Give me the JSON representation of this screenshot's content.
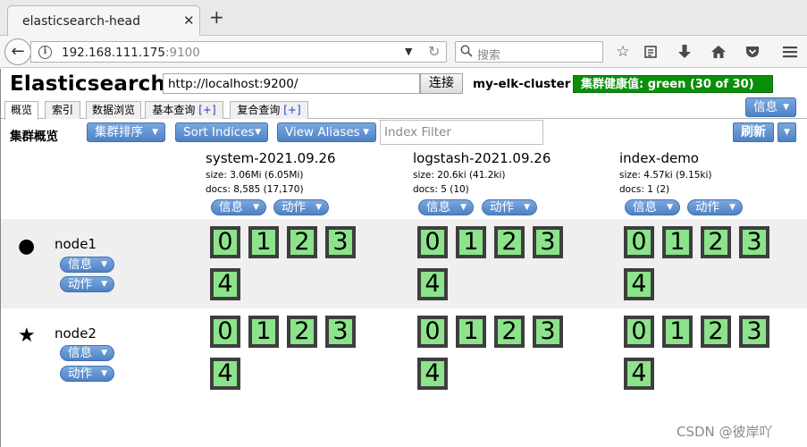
{
  "browser": {
    "tab_title": "elasticsearch-head",
    "tab_close": "✕",
    "new_tab": "+",
    "url_host": "192.168.111.175",
    "url_port": ":9100",
    "search_placeholder": "搜索"
  },
  "app": {
    "title": "Elasticsearch",
    "connection_url": "http://localhost:9200/",
    "connect_label": "连接",
    "cluster_name": "my-elk-cluster",
    "health_label": "集群健康值: ",
    "health_value": "green (30 of 30)",
    "health_color": "#0b8f0b",
    "tabs": [
      {
        "label": "概览",
        "plus": ""
      },
      {
        "label": "索引",
        "plus": ""
      },
      {
        "label": "数据浏览",
        "plus": ""
      },
      {
        "label": "基本查询",
        "plus": "[+]"
      },
      {
        "label": "复合查询",
        "plus": "[+]"
      }
    ],
    "info_label": "信息",
    "toolbar": {
      "overview_label": "集群概览",
      "sort_cluster_label": "集群排序",
      "sort_indices_label": "Sort Indices",
      "view_aliases_label": "View Aliases",
      "index_filter_placeholder": "Index Filter",
      "refresh_label": "刷新"
    }
  },
  "indices": [
    {
      "name": "system-2021.09.26",
      "size": "size: 3.06Mi (6.05Mi)",
      "docs": "docs: 8,585 (17,170)",
      "info_label": "信息",
      "action_label": "动作"
    },
    {
      "name": "logstash-2021.09.26",
      "size": "size: 20.6ki (41.2ki)",
      "docs": "docs: 5 (10)",
      "info_label": "信息",
      "action_label": "动作"
    },
    {
      "name": "index-demo",
      "size": "size: 4.57ki (9.15ki)",
      "docs": "docs: 1 (2)",
      "info_label": "信息",
      "action_label": "动作"
    }
  ],
  "nodes": [
    {
      "name": "node1",
      "icon": "●",
      "icon_name": "master-node-dot-icon",
      "info_label": "信息",
      "action_label": "动作",
      "shards": [
        "0",
        "1",
        "2",
        "3",
        "4"
      ]
    },
    {
      "name": "node2",
      "icon": "★",
      "icon_name": "star-node-icon",
      "info_label": "信息",
      "action_label": "动作",
      "shards": [
        "0",
        "1",
        "2",
        "3",
        "4"
      ]
    }
  ],
  "colors": {
    "shard_fill": "#8ce38c",
    "button_blue": "#4f82c6"
  },
  "watermark": "CSDN @彼岸吖"
}
